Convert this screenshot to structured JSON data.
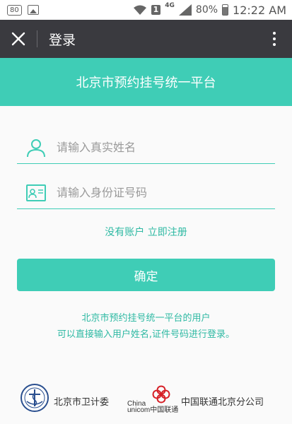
{
  "status_bar": {
    "notification_badge": "80",
    "network": "4G",
    "battery": "80%",
    "time": "12:22 AM",
    "icons": [
      "image-icon",
      "wifi-icon",
      "sim-icon",
      "signal-icon",
      "battery-icon"
    ]
  },
  "header": {
    "title": "登录",
    "close_icon": "close-icon",
    "more_icon": "more-vertical-icon"
  },
  "banner": {
    "title": "北京市预约挂号统一平台"
  },
  "form": {
    "name_placeholder": "请输入真实姓名",
    "id_placeholder": "请输入身份证号码",
    "name_icon": "user-icon",
    "id_icon": "id-card-icon",
    "register_link": "没有账户 立即注册",
    "confirm_label": "确定"
  },
  "hint": {
    "line1": "北京市预约挂号统一平台的用户",
    "line2": "可以直接输入用户姓名,证件号码进行登录。"
  },
  "footer": {
    "nhc_label": "北京市卫计委",
    "unicom_label": "中国联通北京分公司",
    "unicom_logo_text_1": "China",
    "unicom_logo_text_2": "unicom中国联通"
  },
  "colors": {
    "accent": "#3fcdb6",
    "link": "#2eb9a3",
    "header_bg": "#3a3a3f"
  }
}
